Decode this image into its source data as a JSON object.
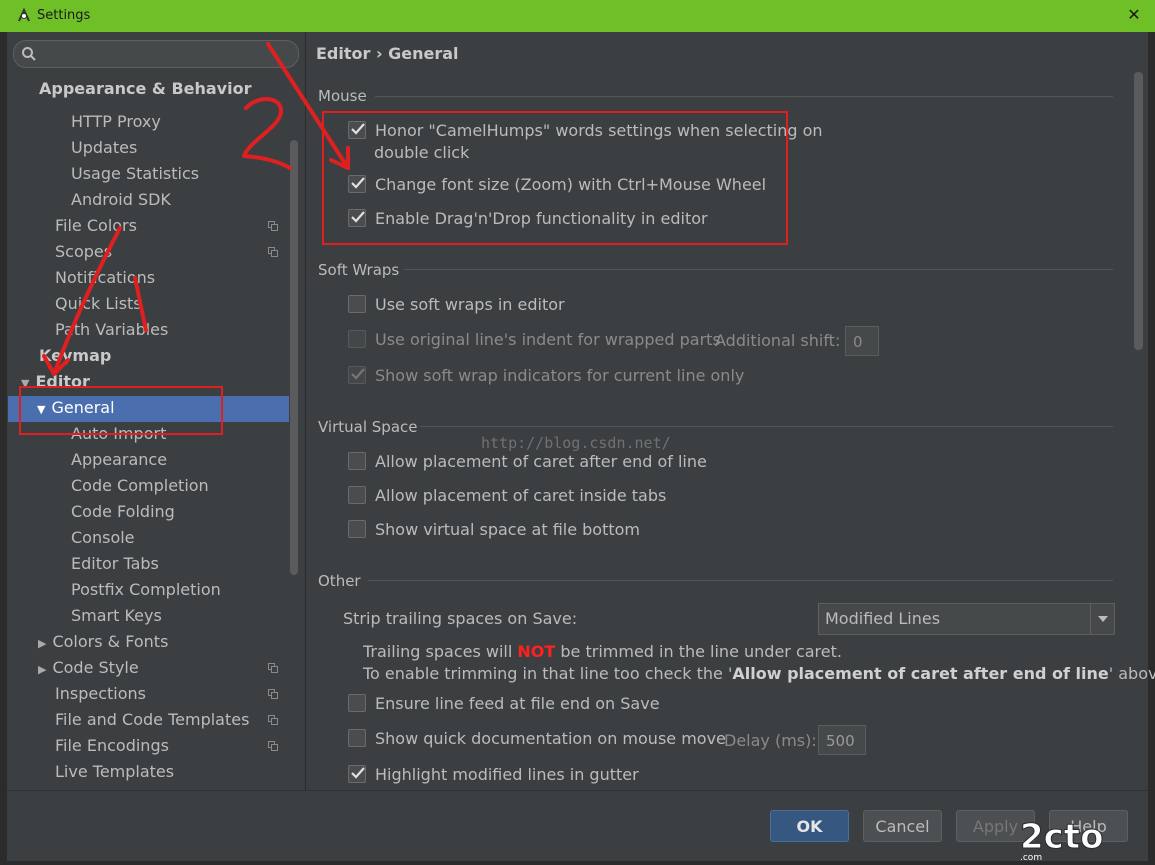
{
  "window": {
    "title": "Settings",
    "close_glyph": "✕"
  },
  "search": {
    "placeholder": ""
  },
  "tree": {
    "items": [
      {
        "label": "Appearance & Behavior",
        "bold": true
      },
      {
        "label": "HTTP Proxy"
      },
      {
        "label": "Updates"
      },
      {
        "label": "Usage Statistics"
      },
      {
        "label": "Android SDK"
      },
      {
        "label": "File Colors"
      },
      {
        "label": "Scopes"
      },
      {
        "label": "Notifications"
      },
      {
        "label": "Quick Lists"
      },
      {
        "label": "Path Variables"
      },
      {
        "label": "Keymap",
        "bold": true
      },
      {
        "label": "Editor",
        "bold": true
      },
      {
        "label": "General",
        "selected": true
      },
      {
        "label": "Auto Import"
      },
      {
        "label": "Appearance"
      },
      {
        "label": "Code Completion"
      },
      {
        "label": "Code Folding"
      },
      {
        "label": "Console"
      },
      {
        "label": "Editor Tabs"
      },
      {
        "label": "Postfix Completion"
      },
      {
        "label": "Smart Keys"
      },
      {
        "label": "Colors & Fonts"
      },
      {
        "label": "Code Style"
      },
      {
        "label": "Inspections"
      },
      {
        "label": "File and Code Templates"
      },
      {
        "label": "File Encodings"
      },
      {
        "label": "Live Templates"
      }
    ]
  },
  "breadcrumb": "Editor › General",
  "sections": {
    "mouse": "Mouse",
    "soft_wraps": "Soft Wraps",
    "virtual_space": "Virtual Space",
    "other": "Other"
  },
  "options": {
    "camel_humps_1": "Honor \"CamelHumps\" words settings when selecting on",
    "camel_humps_2": "double click",
    "zoom": "Change font size (Zoom) with Ctrl+Mouse Wheel",
    "dnd": "Enable Drag'n'Drop functionality in editor",
    "soft_wraps": "Use soft wraps in editor",
    "orig_indent": "Use original line's indent for wrapped parts",
    "additional_shift_label": "Additional shift:",
    "additional_shift_value": "0",
    "wrap_indicators": "Show soft wrap indicators for current line only",
    "caret_after_end": "Allow placement of caret after end of line",
    "caret_inside_tabs": "Allow placement of caret inside tabs",
    "virtual_space_bottom": "Show virtual space at file bottom",
    "strip_label": "Strip trailing spaces on Save:",
    "strip_value": "Modified Lines",
    "note1_pre": "Trailing spaces will ",
    "note1_not": "NOT",
    "note1_post": " be trimmed in the line under caret.",
    "note2_pre": "To enable trimming in that line too check the '",
    "note2_bold": "Allow placement of caret after end of line",
    "note2_post": "' above.",
    "line_feed": "Ensure line feed at file end on Save",
    "quick_doc": "Show quick documentation on mouse move",
    "delay_label": "Delay (ms):",
    "delay_value": "500",
    "highlight_modified": "Highlight modified lines in gutter"
  },
  "watermark": "http://blog.csdn.net/",
  "buttons": {
    "ok": "OK",
    "cancel": "Cancel",
    "apply": "Apply",
    "help": "Help"
  },
  "annotations": {
    "one": "1",
    "two": "2"
  },
  "colors": {
    "titlebar": "#6fbf26",
    "selection": "#4b6eaf",
    "annotation": "#e02020",
    "accent_red": "#ff2020"
  }
}
